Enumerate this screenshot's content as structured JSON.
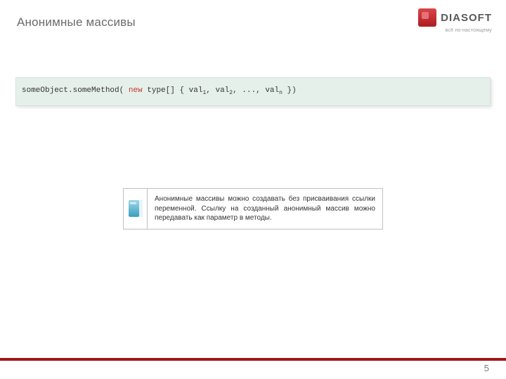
{
  "header": {
    "title": "Анонимные массивы",
    "brand": "DIASOFT",
    "tagline": "всё по-настоящему"
  },
  "code": {
    "prefix": "someObject.someMethod( ",
    "kw_new": "new",
    "after_new": " type[] { val",
    "sub1": "1",
    "sep12": ", val",
    "sub2": "2",
    "mid": ", ..., val",
    "subN": "n",
    "suffix": " })"
  },
  "note": {
    "text": "Анонимные массивы можно создавать без присваивания ссылки переменной. Ссылку на созданный анонимный массив можно передавать как параметр в методы."
  },
  "footer": {
    "page": "5"
  }
}
